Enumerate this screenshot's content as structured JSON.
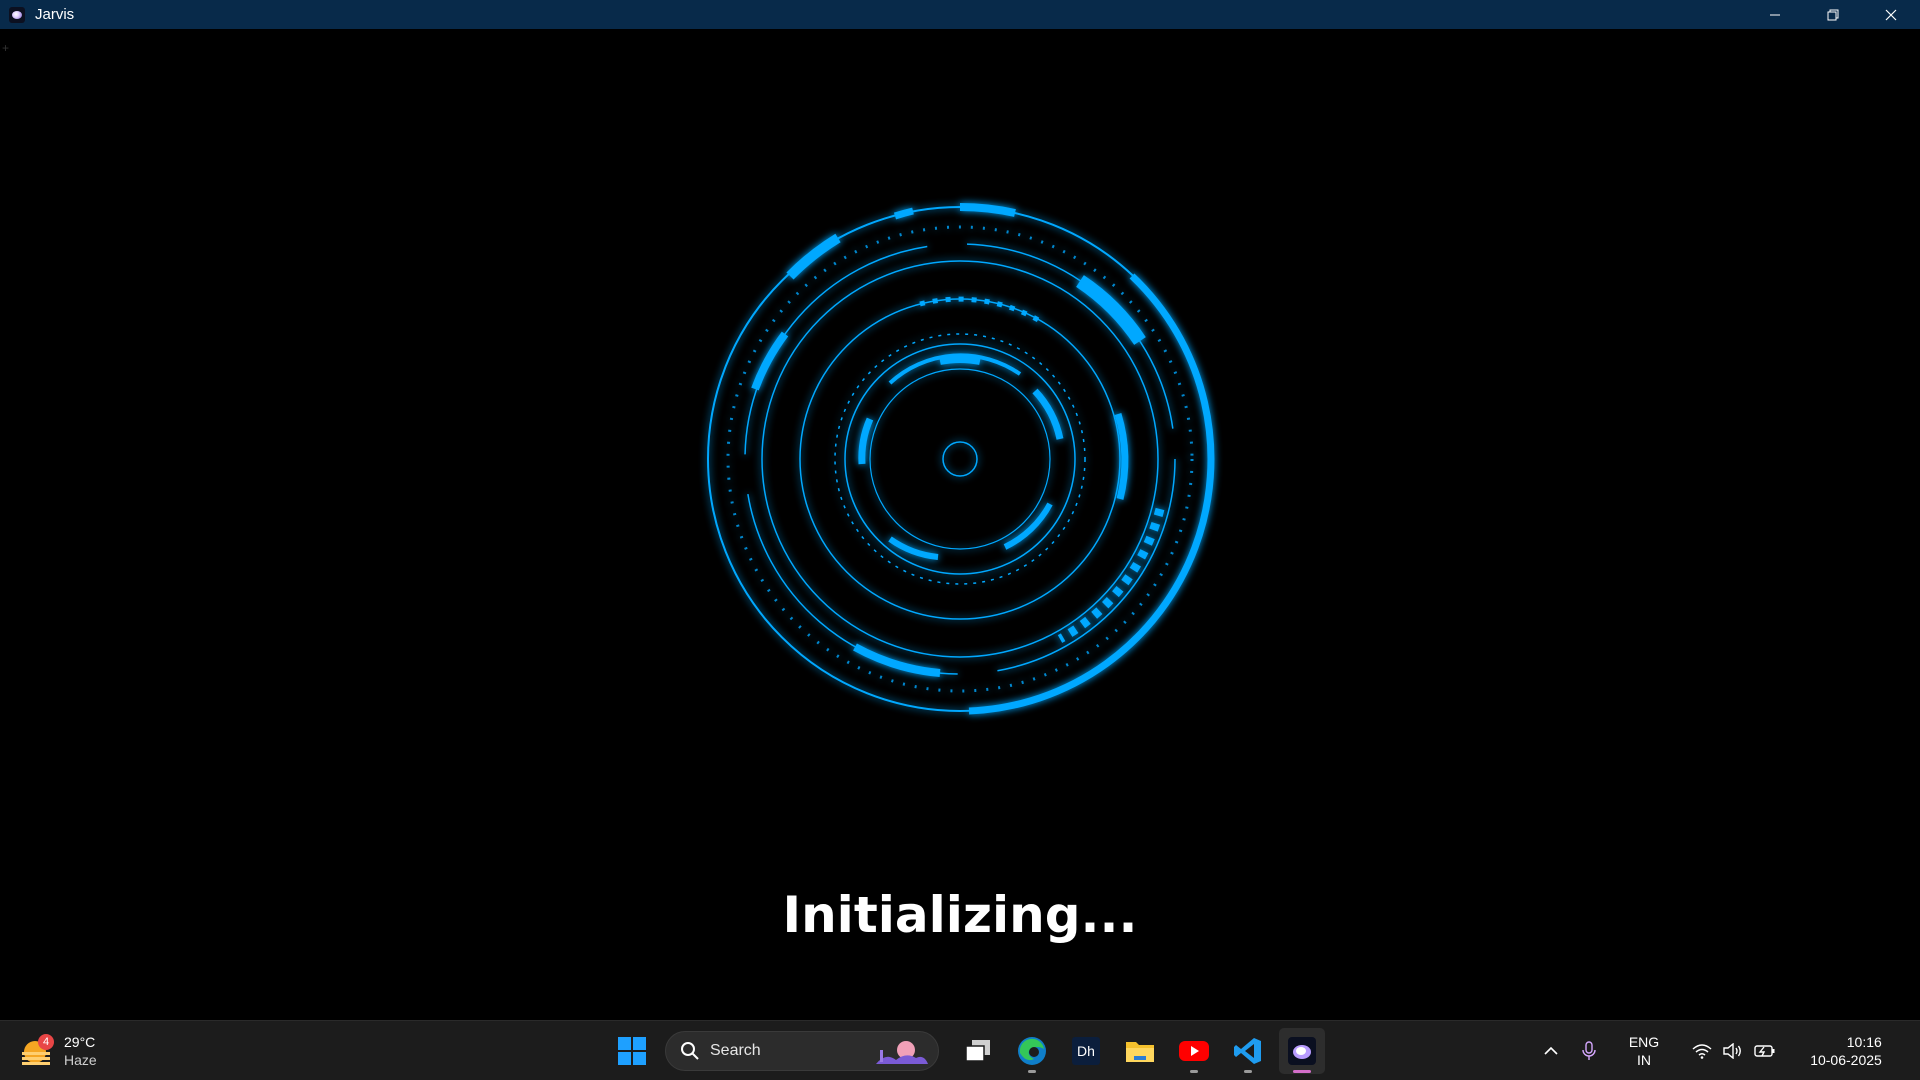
{
  "window": {
    "title": "Jarvis",
    "corner_mark": "+"
  },
  "main": {
    "status_text": "Initializing...",
    "accent_color": "#00a8ff"
  },
  "taskbar": {
    "weather": {
      "temperature": "29°C",
      "condition": "Haze",
      "badge": "4"
    },
    "search": {
      "label": "Search"
    },
    "pinned": [
      {
        "name": "start-button",
        "icon": "windows-logo-icon"
      },
      {
        "name": "task-view",
        "icon": "task-view-icon"
      },
      {
        "name": "edge",
        "icon": "edge-icon"
      },
      {
        "name": "photoshop-like",
        "icon": "app-dh-icon"
      },
      {
        "name": "file-explorer",
        "icon": "folder-icon"
      },
      {
        "name": "youtube",
        "icon": "youtube-icon"
      },
      {
        "name": "vscode",
        "icon": "vscode-icon"
      },
      {
        "name": "jarvis",
        "icon": "jarvis-icon",
        "active": true
      }
    ],
    "tray": {
      "language_line1": "ENG",
      "language_line2": "IN",
      "time": "10:16",
      "date": "10-06-2025"
    }
  }
}
